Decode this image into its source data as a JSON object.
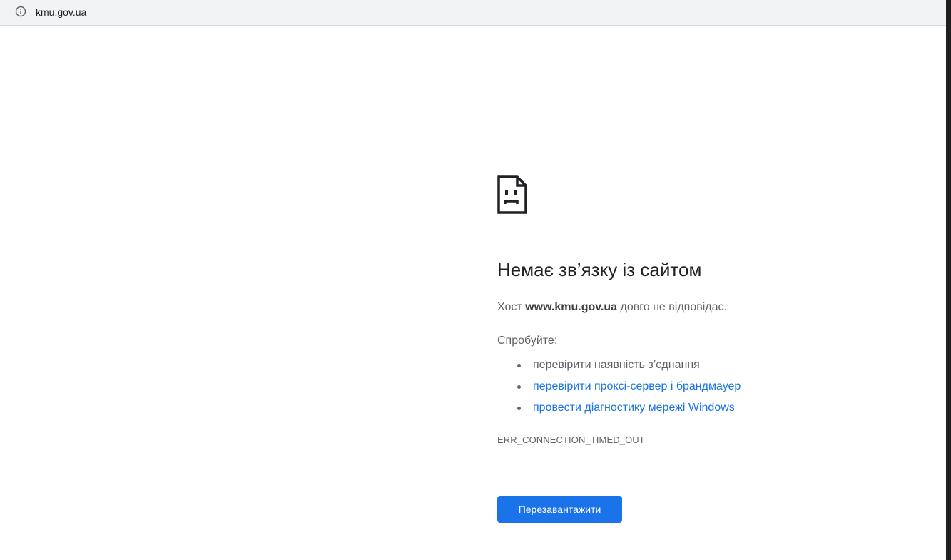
{
  "address_bar": {
    "icon": "info-icon",
    "url": "kmu.gov.ua"
  },
  "error_page": {
    "icon": "sad-page-icon",
    "title": "Немає зв’язку із сайтом",
    "summary": {
      "prefix": "Хост ",
      "host": "www.kmu.gov.ua",
      "suffix": " довго не відповідає."
    },
    "try_label": "Спробуйте:",
    "suggestions": [
      {
        "label": "перевірити наявність з’єднання",
        "is_link": false
      },
      {
        "label": "перевірити проксі-сервер і брандмауер",
        "is_link": true
      },
      {
        "label": "провести діагностику мережі Windows",
        "is_link": true
      }
    ],
    "error_code": "ERR_CONNECTION_TIMED_OUT",
    "reload_label": "Перезавантажити"
  },
  "colors": {
    "accent": "#1a73e8",
    "text": "#202124",
    "secondary_text": "#5f6368",
    "toolbar": "#f1f3f4"
  }
}
